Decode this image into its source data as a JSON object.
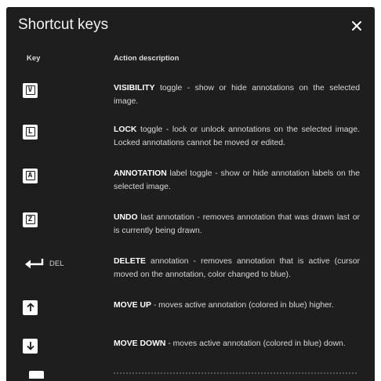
{
  "dialog": {
    "title": "Shortcut keys",
    "close_icon": "close-icon",
    "columns": {
      "key": "Key",
      "action": "Action description"
    }
  },
  "shortcuts": [
    {
      "key": "V",
      "keyword": "VISIBILITY",
      "rest": " toggle - show or hide annotations on the selected image."
    },
    {
      "key": "L",
      "keyword": "LOCK",
      "rest": " toggle - lock or unlock annotations on the selected image. Locked annotations cannot be moved or edited."
    },
    {
      "key": "A",
      "keyword": "ANNOTATION",
      "rest": " label toggle - show or hide annotation labels on the selected image."
    },
    {
      "key": "Z",
      "keyword": "UNDO",
      "rest": " last annotation - removes annotation that was drawn last or is currently being drawn."
    },
    {
      "key_icon": "enter-arrow-icon",
      "key_label": "DEL",
      "keyword": "DELETE",
      "rest": " annotation - removes annotation that is active (cursor moved on the annotation, color changed to blue)."
    },
    {
      "key_icon": "arrow-up-icon",
      "keyword": "MOVE UP",
      "rest": " - moves active annotation (colored in blue) higher."
    },
    {
      "key_icon": "arrow-down-icon",
      "keyword": "MOVE DOWN",
      "rest": " - moves active annotation (colored in blue) down."
    }
  ],
  "colors": {
    "dialog_bg": "#1e1e1e",
    "text": "#d8d8d8",
    "keycap": "#ffffff"
  }
}
